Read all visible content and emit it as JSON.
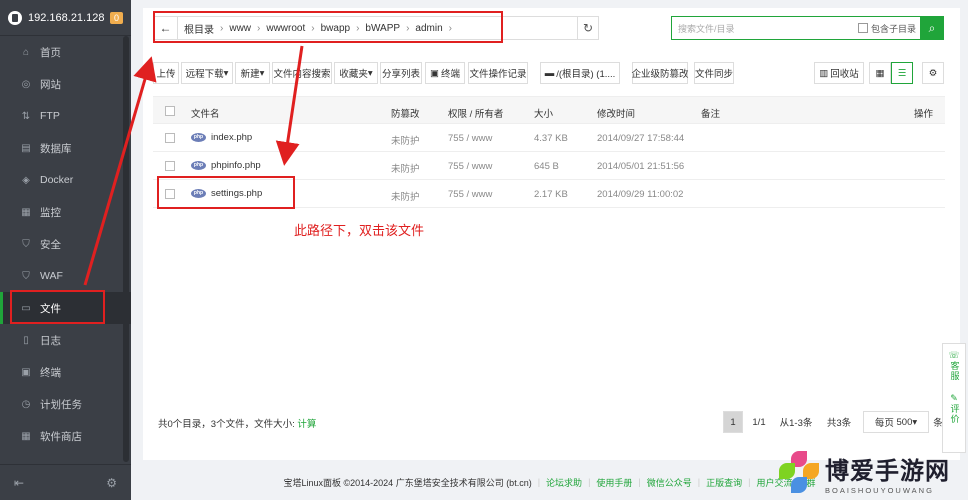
{
  "sidebar": {
    "ip": "192.168.21.128",
    "badge": "0",
    "items": [
      {
        "label": "首页",
        "icon": "home-icon",
        "glyph": "⌂"
      },
      {
        "label": "网站",
        "icon": "globe-icon",
        "glyph": "◎"
      },
      {
        "label": "FTP",
        "icon": "ftp-icon",
        "glyph": "⇅"
      },
      {
        "label": "数据库",
        "icon": "database-icon",
        "glyph": "▤"
      },
      {
        "label": "Docker",
        "icon": "docker-icon",
        "glyph": "◈"
      },
      {
        "label": "监控",
        "icon": "monitor-icon",
        "glyph": "▦"
      },
      {
        "label": "安全",
        "icon": "shield-icon",
        "glyph": "⛉"
      },
      {
        "label": "WAF",
        "icon": "waf-icon",
        "glyph": "⛉"
      },
      {
        "label": "文件",
        "icon": "folder-icon",
        "glyph": "▭"
      },
      {
        "label": "日志",
        "icon": "log-icon",
        "glyph": "▯"
      },
      {
        "label": "终端",
        "icon": "terminal-icon",
        "glyph": "▣"
      },
      {
        "label": "计划任务",
        "icon": "clock-icon",
        "glyph": "◷"
      },
      {
        "label": "软件商店",
        "icon": "store-icon",
        "glyph": "▦"
      }
    ]
  },
  "breadcrumb": [
    "根目录",
    "www",
    "wwwroot",
    "bwapp",
    "bWAPP",
    "admin"
  ],
  "search": {
    "placeholder": "搜索文件/目录",
    "include_sub": "包含子目录"
  },
  "toolbar": {
    "upload": "上传",
    "remote_download": "远程下载",
    "new": "新建",
    "content_search": "文件内容搜索",
    "favorites": "收藏夹",
    "share_list": "分享列表",
    "terminal": "终端",
    "op_log": "文件操作记录",
    "disk": "/(根目录) (1....",
    "tamper": "企业级防篡改",
    "sync": "文件同步",
    "recycle": "回收站"
  },
  "table": {
    "headers": {
      "name": "文件名",
      "tamper": "防篡改",
      "perm": "权限 / 所有者",
      "size": "大小",
      "mtime": "修改时间",
      "note": "备注",
      "action": "操作"
    },
    "rows": [
      {
        "name": "index.php",
        "tamper": "未防护",
        "perm": "755 / www",
        "size": "4.37 KB",
        "mtime": "2014/09/27 17:58:44"
      },
      {
        "name": "phpinfo.php",
        "tamper": "未防护",
        "perm": "755 / www",
        "size": "645 B",
        "mtime": "2014/05/01 21:51:56"
      },
      {
        "name": "settings.php",
        "tamper": "未防护",
        "perm": "755 / www",
        "size": "2.17 KB",
        "mtime": "2014/09/29 11:00:02"
      }
    ]
  },
  "status": {
    "text": "共0个目录，3个文件，文件大小:",
    "calc": "计算"
  },
  "pager": {
    "current": "1",
    "total_pages": "1/1",
    "range": "从1-3条",
    "count": "共3条",
    "per_page": "每页",
    "per_value": "500",
    "unit": "条"
  },
  "annotation": "此路径下，双击该文件",
  "footer": {
    "copyright": "宝塔Linux面板 ©2014-2024 广东堡塔安全技术有限公司 (bt.cn)",
    "links": [
      "论坛求助",
      "使用手册",
      "微信公众号",
      "正版查询",
      "用户交流QQ群"
    ]
  },
  "floater": {
    "service": "客服",
    "review": "评价"
  },
  "watermark": {
    "big": "博爱手游网",
    "small": "BOAISHOUYOUWANG"
  },
  "colors": {
    "accent": "#20a53a",
    "annotation": "#e02020",
    "sidebar": "#3b3f46"
  }
}
